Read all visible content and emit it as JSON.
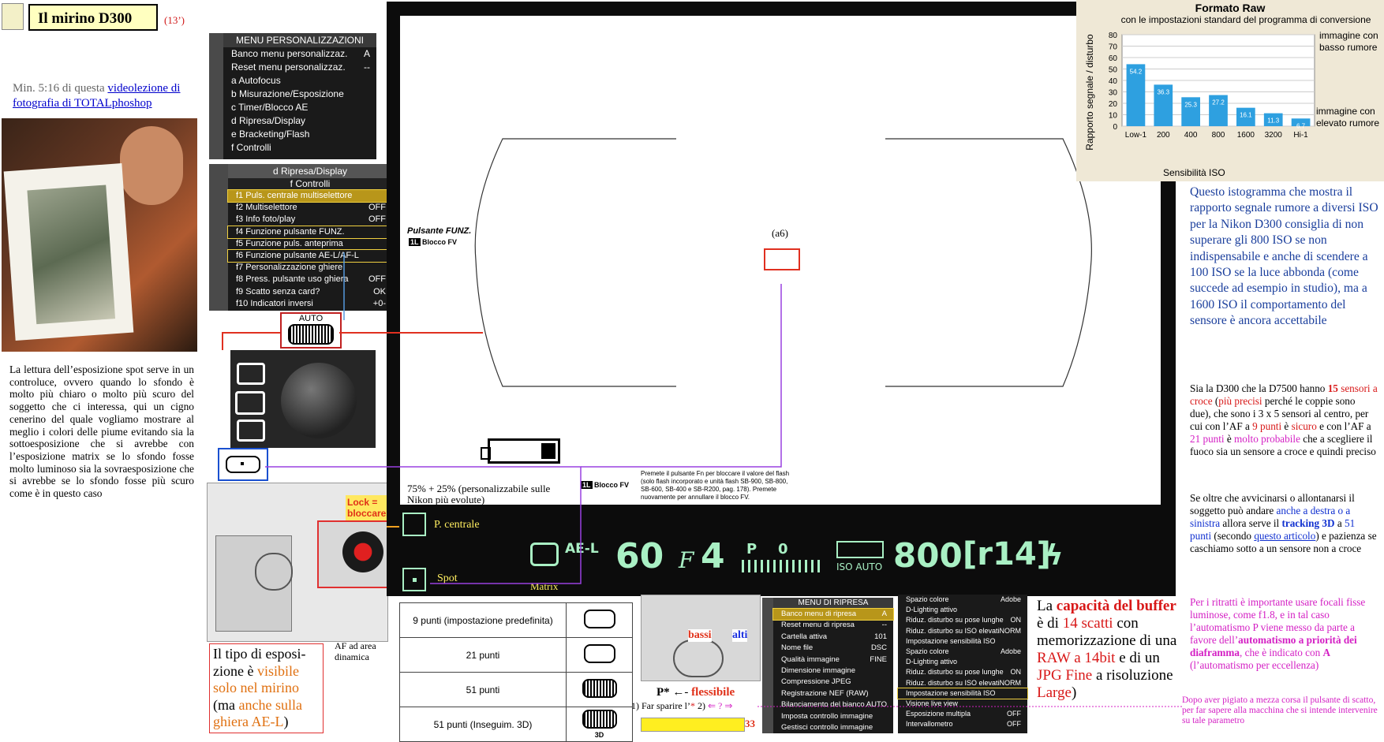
{
  "header": {
    "title": "Il mirino D300",
    "duration": "(13’)",
    "video_prefix": "Min. 5:16 di questa ",
    "video_link": "videolezione di fotografia di TOTALphoshop"
  },
  "left_text": "La lettura dell’esposizione spot serve in un controluce, ovvero quando lo sfondo è molto più chiaro o molto più scuro del soggetto che ci interessa, qui un cigno cenerino del quale vogliamo mostrare al meglio i colori delle piume evitando sia la sottoesposizione che si avrebbe con l’esposizione matrix se lo sfondo fosse molto luminoso sia la sovraesposizione che si avrebbe se lo sfondo fosse più scuro come è in questo caso",
  "menu_custom": {
    "title": "MENU PERSONALIZZAZIONI",
    "items": [
      {
        "label": "Banco menu personalizzaz.",
        "value": "A"
      },
      {
        "label": "Reset menu personalizzaz.",
        "value": "--"
      },
      {
        "label": "a Autofocus",
        "value": ""
      },
      {
        "label": "b Misurazione/Esposizione",
        "value": ""
      },
      {
        "label": "c Timer/Blocco AE",
        "value": ""
      },
      {
        "label": "d Ripresa/Display",
        "value": ""
      },
      {
        "label": "e Bracketing/Flash",
        "value": ""
      },
      {
        "label": "f Controlli",
        "value": ""
      }
    ]
  },
  "menu_controls": {
    "title_top": "d Ripresa/Display",
    "title": "f Controlli",
    "items": [
      {
        "label": "f1 Puls. centrale multiselettore",
        "value": ""
      },
      {
        "label": "f2 Multiselettore",
        "value": "OFF"
      },
      {
        "label": "f3 Info foto/play",
        "value": "OFF"
      },
      {
        "label": "f4 Funzione pulsante FUNZ.",
        "value": ""
      },
      {
        "label": "f5 Funzione puls. anteprima",
        "value": ""
      },
      {
        "label": "f6 Funzione pulsante AE-L/AF-L",
        "value": ""
      },
      {
        "label": "f7 Personalizzazione ghiere",
        "value": ""
      },
      {
        "label": "f8 Press. pulsante uso ghiera",
        "value": "OFF"
      },
      {
        "label": "f9 Scatto senza card?",
        "value": "OK"
      },
      {
        "label": "f10 Indicatori inversi",
        "value": "+0-"
      }
    ]
  },
  "dial_labels": {
    "auto": "AUTO"
  },
  "lock_label": "Lock = bloccare",
  "viewfinder": {
    "pulsante_funz": "Pulsante FUNZ.",
    "blocco_fv": "Blocco FV",
    "blocco_fv_2": "Blocco FV",
    "a6": "(a6)",
    "flash_note": "Premete il pulsante Fn per bloccare il valore del flash (solo flash incorporato e unità flash SB-900, SB-800, SB-600, SB-400 e SB-R200, pag. 178). Premete nuovamente per annullare il blocco FV.",
    "percent_note": "75% + 25% (personalizzabile sulle Nikon più evolute)",
    "p_centrale": "P. centrale",
    "spot": "Spot",
    "matrix": "Matrix"
  },
  "lcd": {
    "ael": "AE-L",
    "shutter": "60",
    "aperture_f": "F",
    "aperture": "4",
    "program": "P",
    "ev": "0",
    "iso": "800",
    "iso_auto": "ISO AUTO",
    "frames": "[r14]"
  },
  "chart_data": {
    "type": "bar",
    "title": "Formato Raw",
    "subtitle": "con le impostazioni standard del programma di conversione",
    "xlabel": "Sensibilità ISO",
    "ylabel": "Rapporto segnale / disturbo",
    "ylim": [
      0,
      80
    ],
    "yticks": [
      0,
      10,
      20,
      30,
      40,
      50,
      60,
      70,
      80
    ],
    "categories": [
      "Low-1",
      "200",
      "400",
      "800",
      "1600",
      "3200",
      "Hi-1"
    ],
    "values": [
      54.2,
      36.3,
      25.3,
      27.2,
      16.1,
      11.3,
      6.7
    ],
    "value_labels": [
      "54.2",
      "36.3",
      "25.3",
      "27.2",
      "16.1",
      "11.3",
      "6.7"
    ],
    "annot_low": "immagine con basso rumore",
    "annot_high": "immagine con elevato rumore",
    "color": "#2ea0e0"
  },
  "right_blue_text": "Questo istogramma che mostra il rapporto segnale rumore a diversi ISO per la Nikon D300 consiglia di non superare gli 800 ISO se non indispensabile e anche di scendere a 100 ISO se la luce abbonda (come succede ad esempio in studio), ma a 1600 ISO il comportamento del sensore è ancora accettabile",
  "right_af": {
    "p1": "Sia la D300 che la D7500 hanno",
    "n15": "15",
    "p2": "sensori a croce",
    "p3": "(",
    "p4": "più precisi",
    "p5": "perché le coppie sono due), che sono i 3 x 5 sensori al centro, per cui con l’AF a",
    "n9": "9 punti",
    "p6": "è",
    "p7": "sicuro",
    "p8": "e con l’AF a",
    "n21": "21 punti",
    "p9": "è",
    "p10": "molto probabile",
    "p11": "che a scegliere il fuoco sia un sensore a croce e quindi preciso"
  },
  "right_track": {
    "p1": "Se oltre che avvicinarsi o allontanarsi il soggetto può andare",
    "p2": "anche a destra o a sinistra",
    "p3": "allora serve il",
    "p4": "tracking 3D",
    "p5": "a",
    "p6": "51 punti",
    "p7": "(secondo",
    "p8": "questo articolo",
    "p9": ") e pazienza se caschiamo sotto a un sensore non a croce"
  },
  "right_portrait": {
    "p1": "Per i ritratti è importante usare focali fisse luminose, come f1.8, e in tal caso l’automatismo P viene messo da parte a favore dell’",
    "p2": "automatismo a priorità dei diaframma",
    "p3": ", che è indicato con",
    "p4": "A",
    "p5": "(l’automatismo per eccellenza)"
  },
  "right_footer": "Dopo aver pigiato a mezza corsa il pulsante di scatto, per far sapere alla macchina che si intende intervenire su tale parametro",
  "af_table": {
    "rows": [
      "9 punti (impostazione predefinita)",
      "21 punti",
      "51 punti",
      "51 punti (Inseguim. 3D)"
    ],
    "side_label": "AF ad area dinamica",
    "tag_3d": "3D"
  },
  "bottom_left": {
    "p1": "Il tipo di esposi-zione è",
    "p2": "visibile solo nel mirino",
    "p3": "(ma",
    "p4": "anche sulla ghiera AE-L",
    "p5": ")"
  },
  "flex_area": {
    "bassi": "bassi",
    "alti": "alti",
    "p_star": "P*",
    "flessibile": "flessibile",
    "far_sparire": "1) Far sparire l’",
    "star": "*",
    "step2": "2)",
    "arrow_q": "⇐ ? ⇒",
    "page": "33"
  },
  "menu_shoot": {
    "title": "MENU DI RIPRESA",
    "items": [
      {
        "label": "Banco menu di ripresa",
        "value": "A"
      },
      {
        "label": "Reset menu di ripresa",
        "value": "--"
      },
      {
        "label": "Cartella attiva",
        "value": "101"
      },
      {
        "label": "Nome file",
        "value": "DSC"
      },
      {
        "label": "Qualità immagine",
        "value": "FINE"
      },
      {
        "label": "Dimensione immagine",
        "value": ""
      },
      {
        "label": "Compressione JPEG",
        "value": ""
      },
      {
        "label": "Registrazione NEF (RAW)",
        "value": ""
      },
      {
        "label": "Bilanciamento del bianco",
        "value": "AUTO"
      },
      {
        "label": "Imposta controllo immagine",
        "value": ""
      },
      {
        "label": "Gestisci controllo immagine",
        "value": ""
      }
    ]
  },
  "menu_shoot2": {
    "items": [
      {
        "label": "Spazio colore",
        "value": "Adobe"
      },
      {
        "label": "D-Lighting attivo",
        "value": ""
      },
      {
        "label": "Riduz. disturbo su pose lunghe",
        "value": "ON"
      },
      {
        "label": "Riduz. disturbo su ISO elevati",
        "value": "NORM"
      },
      {
        "label": "Impostazione sensibilità ISO",
        "value": ""
      },
      {
        "label": "Spazio colore",
        "value": "Adobe"
      },
      {
        "label": "D-Lighting attivo",
        "value": ""
      },
      {
        "label": "Riduz. disturbo su pose lunghe",
        "value": "ON"
      },
      {
        "label": "Riduz. disturbo su ISO elevati",
        "value": "NORM"
      },
      {
        "label": "Impostazione sensibilità ISO",
        "value": ""
      },
      {
        "label": "Visione live view",
        "value": ""
      },
      {
        "label": "Esposizione multipla",
        "value": "OFF"
      },
      {
        "label": "Intervallometro",
        "value": "OFF"
      }
    ]
  },
  "buffer": {
    "p1": "La",
    "p2": "capacità del buffer",
    "p3": "è di",
    "p4": "14 scatti",
    "p5": "con memorizzazione di una",
    "p6": "RAW a 14bit",
    "p7": "e di un",
    "p8": "JPG Fine",
    "p9": "a risoluzione",
    "p10": "Large",
    "p11": ")"
  }
}
